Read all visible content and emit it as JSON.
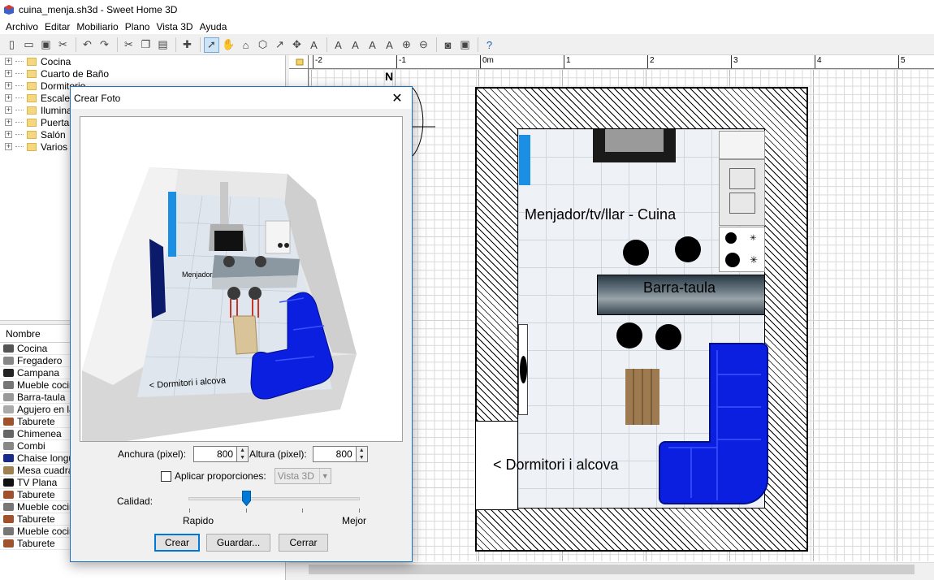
{
  "window": {
    "title": "cuina_menja.sh3d - Sweet Home 3D"
  },
  "menu": [
    "Archivo",
    "Editar",
    "Mobiliario",
    "Plano",
    "Vista 3D",
    "Ayuda"
  ],
  "catalog": {
    "categories": [
      "Cocina",
      "Cuarto de Baño",
      "Dormitorio",
      "Escaleras",
      "Iluminación",
      "Puertas y",
      "Salón",
      "Varios"
    ]
  },
  "furniture": {
    "header": "Nombre",
    "items": [
      "Cocina",
      "Fregadero",
      "Campana",
      "Mueble cocina",
      "Barra-taula",
      "Agujero en la",
      "Taburete",
      "Chimenea",
      "Combi",
      "Chaise longue",
      "Mesa cuadrada",
      "TV Plana",
      "Taburete",
      "Mueble cocina",
      "Taburete",
      "Mueble cocina",
      "Taburete"
    ]
  },
  "plan": {
    "ruler_labels": [
      "-2",
      "-1",
      "0m",
      "1",
      "2",
      "3",
      "4",
      "5"
    ],
    "compass": "N",
    "room_label": "Menjador/tv/llar - Cuina",
    "bar_label": "Barra-taula",
    "alcove_label": "< Dormitori i alcova"
  },
  "dialog": {
    "title": "Crear Foto",
    "width_label": "Anchura (pixel):",
    "width_value": "800",
    "height_label": "Altura (pixel):",
    "height_value": "800",
    "aspect_label": "Aplicar proporciones:",
    "aspect_value": "Vista 3D",
    "aspect_checked": false,
    "quality_label": "Calidad:",
    "quality_min": "Rapido",
    "quality_max": "Mejor",
    "quality_level": 0.33,
    "preview_label_table": "Menjador",
    "preview_label_alcove": "< Dormitori i alcova",
    "buttons": {
      "create": "Crear",
      "save": "Guardar...",
      "close": "Cerrar"
    }
  },
  "colors": {
    "accent": "#0078d7",
    "sofa": "#0a1fe0",
    "selection": "#cce4f7"
  }
}
